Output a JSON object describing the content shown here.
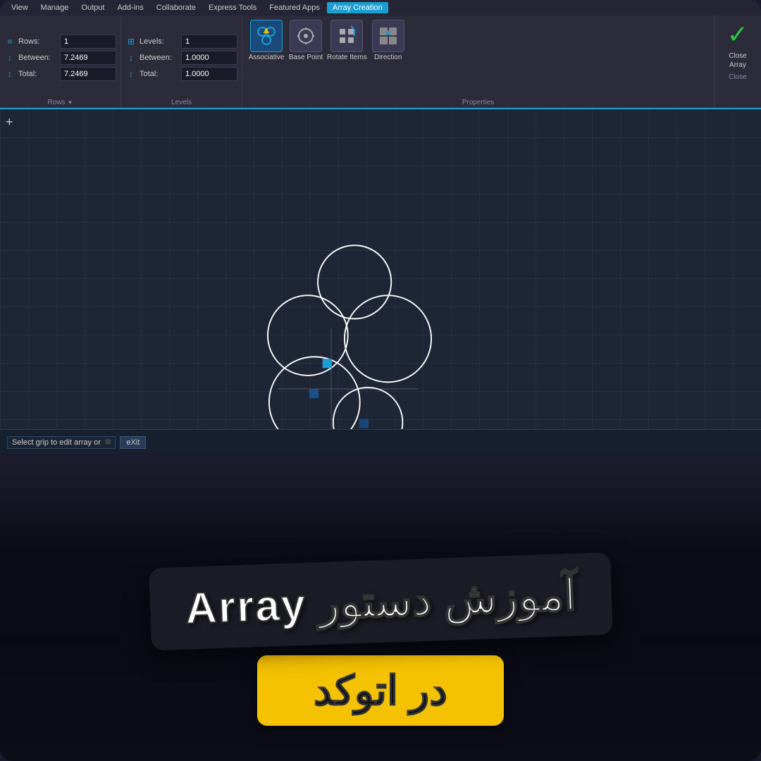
{
  "menu": {
    "items": [
      "View",
      "Manage",
      "Output",
      "Add-ins",
      "Collaborate",
      "Express Tools",
      "Featured Apps",
      "Array Creation"
    ],
    "active": "Array Creation"
  },
  "toolbar": {
    "rows_section": {
      "label": "Rows",
      "fields": [
        {
          "icon": "≡",
          "label": "Rows:",
          "value": "1"
        },
        {
          "icon": "↕",
          "label": "Between:",
          "value": "7.2469"
        },
        {
          "icon": "↕",
          "label": "Total:",
          "value": "7.2469"
        }
      ]
    },
    "levels_section": {
      "label": "Levels",
      "fields": [
        {
          "icon": "⊞",
          "label": "Levels:",
          "value": "1"
        },
        {
          "icon": "↕",
          "label": "Between:",
          "value": "1.0000"
        },
        {
          "icon": "↕",
          "label": "Total:",
          "value": "1.0000"
        }
      ]
    },
    "properties": {
      "label": "Properties",
      "buttons": [
        {
          "icon": "⚡",
          "label": "Associative",
          "active": true
        },
        {
          "icon": "⊕",
          "label": "Base Point",
          "active": false
        },
        {
          "icon": "⊞",
          "label": "Rotate Items",
          "active": false
        },
        {
          "icon": "→",
          "label": "Direction",
          "active": false
        }
      ]
    },
    "close": {
      "label": "Close",
      "sublabel": "Array",
      "section_label": "Close"
    }
  },
  "canvas": {
    "add_btn": "+",
    "command": {
      "text": "Select grip to edit array or",
      "icon": "⊞",
      "exit": "eXit"
    }
  },
  "banner": {
    "title_line1": "آموزش دستور Array",
    "title_line2": "در اتوکد"
  }
}
